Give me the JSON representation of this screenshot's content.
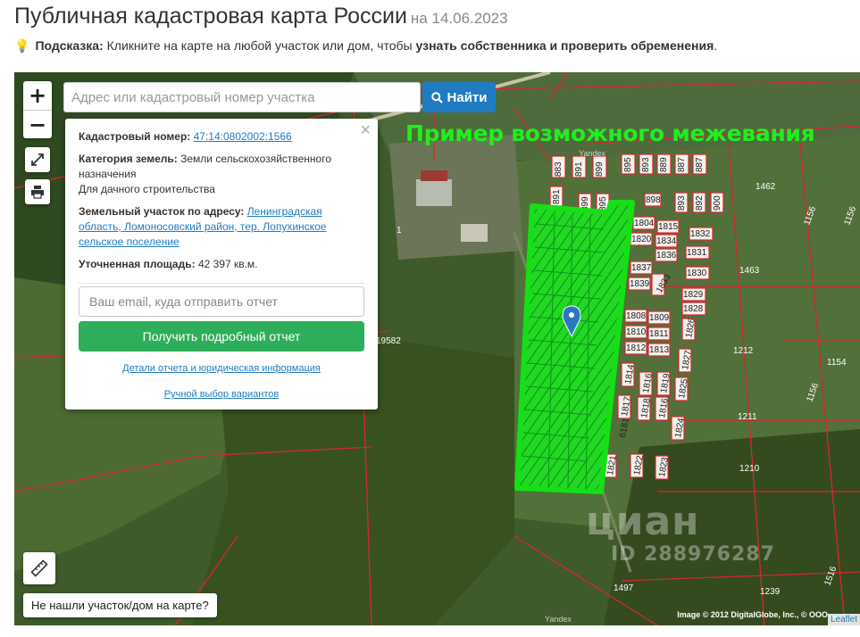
{
  "header": {
    "title": "Публичная кадастровая карта России",
    "date": "на 14.06.2023"
  },
  "hint": {
    "label": "Подсказка:",
    "text": "Кликните на карте на любой участок или дом, чтобы",
    "bold": "узнать собственника и проверить обременения",
    "end": "."
  },
  "map": {
    "search_placeholder": "Адрес или кадастровый номер участка",
    "search_button": "Найти",
    "zoom_in": "+",
    "zoom_out": "−",
    "overlay_title": "Пример возможного межевания",
    "not_found_button": "Не нашли участок/дом на карте?",
    "watermark_brand": "циан",
    "watermark_id": "ID 288976287",
    "attribution": "Image © 2012 DigitalGlobe, Inc., © OOO ...",
    "leaflet": "Leaflet",
    "yandex_label": "Yandex"
  },
  "popup": {
    "cadastral_label": "Кадастровый номер:",
    "cadastral_value": "47:14:0802002:1566",
    "category_label": "Категория земель:",
    "category_value": "Земли сельскохозяйственного назначения",
    "usage": "Для дачного строительства",
    "address_label": "Земельный участок по адресу:",
    "address_value": "Ленинградская область, Ломоносовский район, тер. Лопухинское сельское поселение",
    "area_label": "Уточненная площадь:",
    "area_value": "42 397 кв.м.",
    "email_placeholder": "Ваш email, куда отправить отчет",
    "report_button": "Получить подробный отчет",
    "details_link": "Детали отчета и юридическая информация",
    "manual_link": "Ручной выбор вариантов",
    "close": "×"
  },
  "parcel_labels": [
    "883",
    "891",
    "899",
    "895",
    "893",
    "889",
    "887",
    "898",
    "892",
    "900",
    "1804",
    "1815",
    "1832",
    "1820",
    "1834",
    "1836",
    "1831",
    "1837",
    "1830",
    "1833",
    "1829",
    "1828",
    "1808",
    "1809",
    "1810",
    "1811",
    "1812",
    "1813",
    "1827",
    "1814",
    "1817",
    "1818",
    "1816",
    "1819",
    "1825",
    "1824",
    "1821",
    "1822",
    "1823",
    "1462",
    "1463",
    "1156",
    "1212",
    "1154",
    "1211",
    "1210",
    "1497",
    "1239",
    "1516",
    "1",
    "19582"
  ],
  "colors": {
    "accent_blue": "#1f7cc2",
    "report_green": "#2eae5a",
    "overlay_green": "#1fef1f",
    "boundary_red": "#d9262f"
  }
}
